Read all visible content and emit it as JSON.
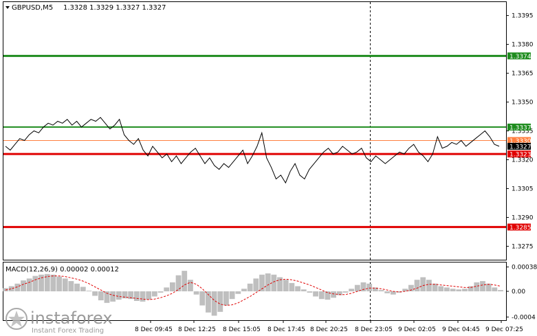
{
  "header": {
    "symbol_label": "GBPUSD,M5",
    "ohlc": "1.3328 1.3329 1.3327 1.3327"
  },
  "macd_panel": {
    "label": "MACD(12,26,9) 0.00002 0.00012"
  },
  "watermark": {
    "brand": "instaforex",
    "tagline": "Instant Forex Trading"
  },
  "colors": {
    "price_line": "#000000",
    "support_resistance_green": "#1e8c1e",
    "support_resistance_red": "#e00000",
    "thin_orange": "#ff7f3f",
    "macd_hist": "#bfbfbf",
    "macd_signal": "#e00000",
    "current_price_tag": "#000000"
  },
  "chart_data": [
    {
      "type": "line",
      "title": "GBPUSD,M5",
      "ylim": [
        1.3268,
        1.3402
      ],
      "y_ticks": [
        "1.3395",
        "1.3380",
        "1.3365",
        "1.3350",
        "1.3335",
        "1.3320",
        "1.3305",
        "1.3290",
        "1.3275"
      ],
      "x_ticks": [
        "8 Dec 09:45",
        "8 Dec 12:25",
        "8 Dec 15:05",
        "8 Dec 17:45",
        "8 Dec 20:25",
        "8 Dec 23:05",
        "9 Dec 02:05",
        "9 Dec 04:45",
        "9 Dec 07:25"
      ],
      "horizontal_levels": [
        {
          "value": 1.3374,
          "label": "1.3374",
          "color": "#1e8c1e"
        },
        {
          "value": 1.3337,
          "label": "1.3337",
          "color": "#1e8c1e"
        },
        {
          "value": 1.333,
          "label": "1.3330",
          "color": "#ff7f3f"
        },
        {
          "value": 1.3323,
          "label": "1.3323",
          "color": "#e00000"
        },
        {
          "value": 1.3285,
          "label": "1.3285",
          "color": "#e00000"
        }
      ],
      "current_price": {
        "value": 1.3327,
        "label": "1.3327"
      },
      "grid": false,
      "series": [
        {
          "values": [
            1.3327,
            1.3325,
            1.3328,
            1.3331,
            1.333,
            1.3333,
            1.3335,
            1.3334,
            1.3337,
            1.3339,
            1.3338,
            1.334,
            1.3339,
            1.3341,
            1.3338,
            1.334,
            1.3337,
            1.3339,
            1.3341,
            1.334,
            1.3342,
            1.3339,
            1.3336,
            1.3338,
            1.3341,
            1.3333,
            1.333,
            1.3328,
            1.3331,
            1.3325,
            1.3322,
            1.3327,
            1.3324,
            1.3321,
            1.3323,
            1.3319,
            1.3322,
            1.3318,
            1.3321,
            1.3324,
            1.3326,
            1.3322,
            1.3318,
            1.3321,
            1.3317,
            1.3315,
            1.3318,
            1.3316,
            1.3319,
            1.3322,
            1.3325,
            1.3318,
            1.3322,
            1.3327,
            1.3334,
            1.3321,
            1.3316,
            1.331,
            1.3312,
            1.3308,
            1.3314,
            1.3318,
            1.3312,
            1.331,
            1.3315,
            1.3318,
            1.3321,
            1.3324,
            1.3326,
            1.3323,
            1.3324,
            1.3327,
            1.3325,
            1.3323,
            1.3324,
            1.3326,
            1.3321,
            1.3319,
            1.3322,
            1.332,
            1.3318,
            1.332,
            1.3322,
            1.3324,
            1.3323,
            1.3326,
            1.3328,
            1.3324,
            1.3322,
            1.3319,
            1.3323,
            1.3332,
            1.3326,
            1.3327,
            1.3329,
            1.3328,
            1.333,
            1.3327,
            1.3329,
            1.3331,
            1.3333,
            1.3335,
            1.3332,
            1.3328,
            1.3327
          ],
          "color": "#000000"
        }
      ]
    },
    {
      "type": "bar",
      "title": "MACD(12,26,9)",
      "ylim": [
        -0.00045,
        0.00045
      ],
      "y_ticks": [
        "0.00038",
        "0.00",
        "-0.0004"
      ],
      "series": [
        {
          "values": [
            5e-05,
            8e-05,
            0.00012,
            0.00017,
            0.0002,
            0.00024,
            0.00026,
            0.00027,
            0.00026,
            0.00023,
            0.0002,
            0.00016,
            0.00012,
            7e-05,
            1e-05,
            -7e-05,
            -0.00014,
            -0.00018,
            -0.00016,
            -0.00013,
            -0.00011,
            -0.00012,
            -0.00015,
            -0.00016,
            -0.00013,
            -8e-05,
            -2e-05,
            6e-05,
            0.00014,
            0.00025,
            0.00032,
            0.00018,
            -5e-05,
            -0.00022,
            -0.00033,
            -0.00038,
            -0.00032,
            -0.00022,
            -0.00012,
            -4e-05,
            4e-05,
            0.00012,
            0.0002,
            0.00026,
            0.00028,
            0.00026,
            0.00022,
            0.00018,
            0.00013,
            8e-05,
            3e-05,
            -2e-05,
            -8e-05,
            -0.00012,
            -0.00013,
            -0.0001,
            -6e-05,
            -2e-05,
            4e-05,
            0.0001,
            0.00014,
            0.00012,
            6e-05,
            2e-05,
            -3e-05,
            -5e-05,
            -2e-05,
            4e-05,
            0.0001,
            0.00018,
            0.00022,
            0.00018,
            0.00012,
            8e-05,
            6e-05,
            4e-05,
            3e-05,
            4e-05,
            8e-05,
            0.00014,
            0.00016,
            0.00012,
            6e-05,
            2e-05
          ]
        },
        {
          "values": [
            2e-05,
            4e-05,
            7e-05,
            0.00011,
            0.00014,
            0.00018,
            0.00021,
            0.00023,
            0.00024,
            0.00024,
            0.00023,
            0.00021,
            0.00019,
            0.00016,
            0.00012,
            7e-05,
            2e-05,
            -3e-05,
            -6e-05,
            -8e-05,
            -9e-05,
            -0.0001,
            -0.00011,
            -0.00012,
            -0.00013,
            -0.00012,
            -0.0001,
            -7e-05,
            -3e-05,
            3e-05,
            0.0001,
            0.00014,
            0.00011,
            4e-05,
            -5e-05,
            -0.00014,
            -0.0002,
            -0.00022,
            -0.00021,
            -0.00018,
            -0.00013,
            -8e-05,
            -2e-05,
            4e-05,
            0.0001,
            0.00015,
            0.00018,
            0.00019,
            0.00018,
            0.00016,
            0.00013,
            0.0001,
            6e-05,
            2e-05,
            -2e-05,
            -4e-05,
            -5e-05,
            -5e-05,
            -3e-05,
            0.0,
            3e-05,
            5e-05,
            5e-05,
            4e-05,
            2e-05,
            0.0,
            -1e-05,
            0.0,
            2e-05,
            5e-05,
            9e-05,
            0.00011,
            0.00011,
            0.0001,
            9e-05,
            8e-05,
            7e-05,
            6e-05,
            6e-05,
            8e-05,
            0.0001,
            0.00011,
            0.0001,
            8e-05
          ],
          "color": "#e00000"
        }
      ]
    }
  ]
}
